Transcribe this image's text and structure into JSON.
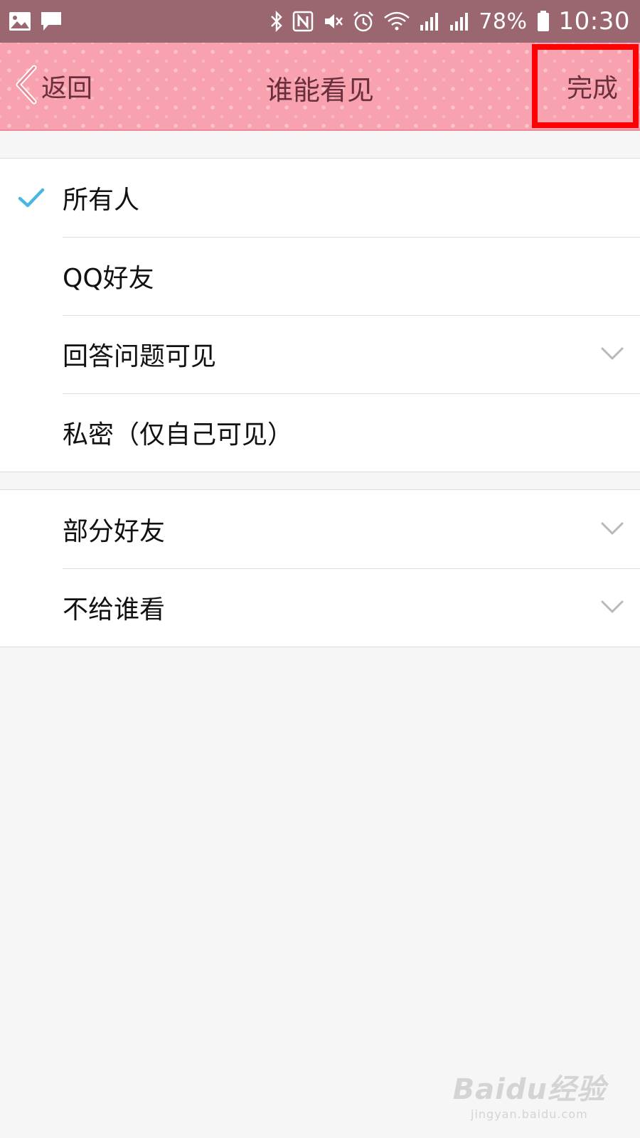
{
  "status_bar": {
    "icons_left": [
      "gallery-icon",
      "message-icon"
    ],
    "icons_right": [
      "bluetooth-icon",
      "nfc-icon",
      "mute-icon",
      "alarm-icon",
      "wifi-icon",
      "signal-icon",
      "signal-4g-icon",
      "battery-icon"
    ],
    "battery": "78%",
    "time": "10:30"
  },
  "header": {
    "back_label": "返回",
    "title": "谁能看见",
    "done_label": "完成",
    "background_color": "#f7a2ae",
    "text_color": "#6a2f3c",
    "highlight_color": "#ff0000"
  },
  "options_group1": [
    {
      "label": "所有人",
      "selected": true
    },
    {
      "label": "QQ好友",
      "selected": false
    },
    {
      "label": "回答问题可见",
      "selected": false,
      "expandable": true
    },
    {
      "label": "私密（仅自己可见）",
      "selected": false
    }
  ],
  "options_group2": [
    {
      "label": "部分好友",
      "selected": false,
      "expandable": true
    },
    {
      "label": "不给谁看",
      "selected": false,
      "expandable": true
    }
  ],
  "check_color": "#4ab7e0",
  "watermark": {
    "logo": "Baidu经验",
    "sub": "jingyan.baidu.com"
  }
}
